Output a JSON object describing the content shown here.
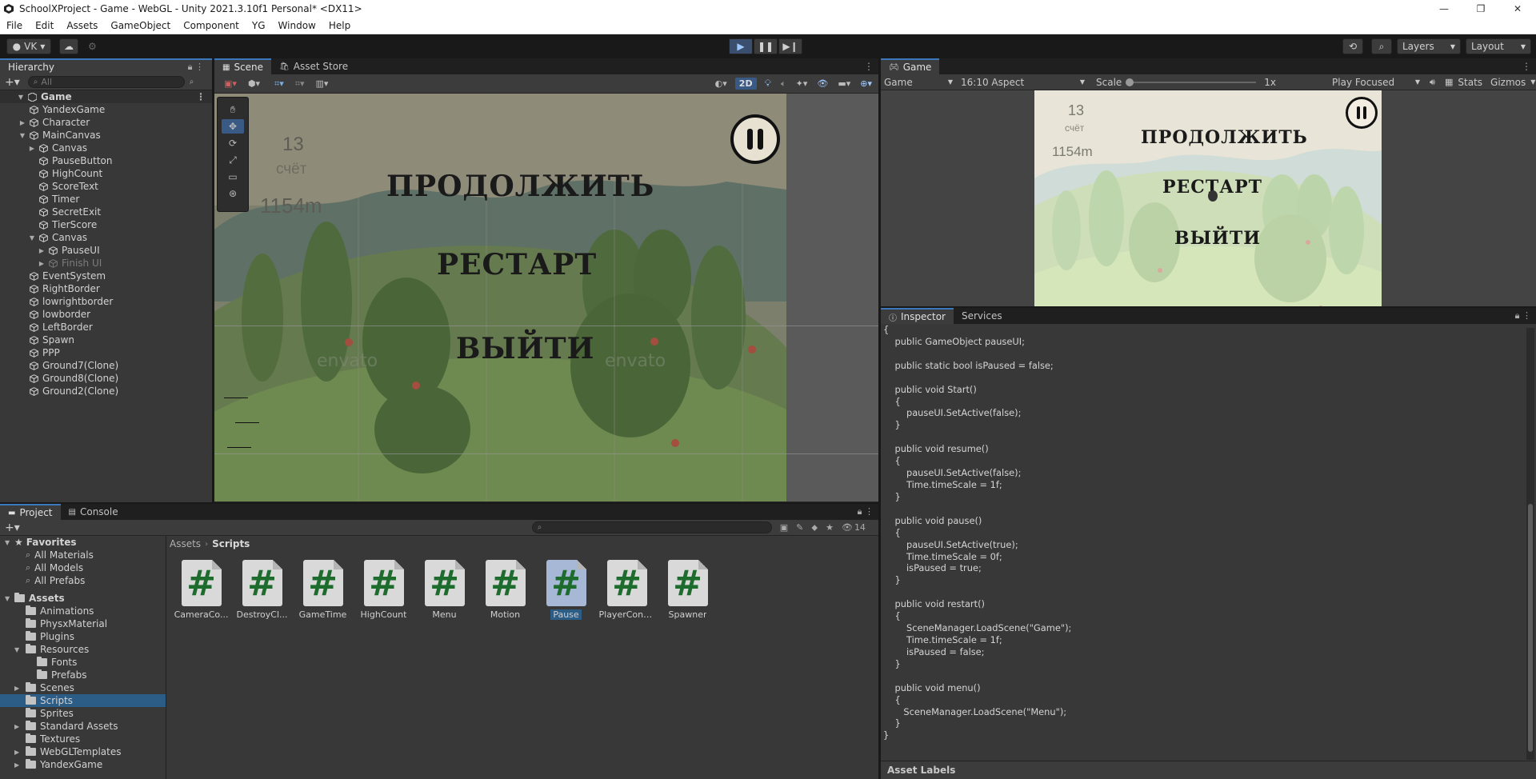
{
  "window": {
    "title": "SchoolXProject - Game - WebGL - Unity 2021.3.10f1 Personal* <DX11>",
    "controls": [
      "—",
      "❐",
      "✕"
    ]
  },
  "menu": [
    "File",
    "Edit",
    "Assets",
    "GameObject",
    "Component",
    "YG",
    "Window",
    "Help"
  ],
  "toolbar": {
    "account": "VK",
    "layers": "Layers",
    "layout": "Layout"
  },
  "hierarchy": {
    "tab": "Hierarchy",
    "search_placeholder": "All",
    "scene": "Game",
    "items": [
      {
        "label": "YandexGame",
        "indent": 1,
        "arrow": ""
      },
      {
        "label": "Character",
        "indent": 1,
        "arrow": "▶"
      },
      {
        "label": "MainCanvas",
        "indent": 1,
        "arrow": "▼"
      },
      {
        "label": "Canvas",
        "indent": 2,
        "arrow": "▶"
      },
      {
        "label": "PauseButton",
        "indent": 2,
        "arrow": ""
      },
      {
        "label": "HighCount",
        "indent": 2,
        "arrow": ""
      },
      {
        "label": "ScoreText",
        "indent": 2,
        "arrow": ""
      },
      {
        "label": "Timer",
        "indent": 2,
        "arrow": ""
      },
      {
        "label": "SecretExit",
        "indent": 2,
        "arrow": ""
      },
      {
        "label": "TierScore",
        "indent": 2,
        "arrow": ""
      },
      {
        "label": "Canvas",
        "indent": 2,
        "arrow": "▼"
      },
      {
        "label": "PauseUI",
        "indent": 3,
        "arrow": "▶"
      },
      {
        "label": "Finish UI",
        "indent": 3,
        "arrow": "▶",
        "dim": true
      },
      {
        "label": "EventSystem",
        "indent": 1,
        "arrow": ""
      },
      {
        "label": "RightBorder",
        "indent": 1,
        "arrow": ""
      },
      {
        "label": "lowrightborder",
        "indent": 1,
        "arrow": ""
      },
      {
        "label": "lowborder",
        "indent": 1,
        "arrow": ""
      },
      {
        "label": "LeftBorder",
        "indent": 1,
        "arrow": ""
      },
      {
        "label": "Spawn",
        "indent": 1,
        "arrow": ""
      },
      {
        "label": "PPP",
        "indent": 1,
        "arrow": ""
      },
      {
        "label": "Ground7(Clone)",
        "indent": 1,
        "arrow": ""
      },
      {
        "label": "Ground8(Clone)",
        "indent": 1,
        "arrow": ""
      },
      {
        "label": "Ground2(Clone)",
        "indent": 1,
        "arrow": ""
      }
    ]
  },
  "scene": {
    "tabs": [
      "Scene",
      "Asset Store"
    ],
    "mode_2d": "2D",
    "hud": {
      "score": "13",
      "score_label": "счёт",
      "distance": "1154m"
    },
    "menu": {
      "continue": "ПРОДОЛЖИТЬ",
      "restart": "РЕСТАРТ",
      "exit": "ВЫЙТИ"
    },
    "watermark": "envato"
  },
  "game": {
    "tab": "Game",
    "display": "Game",
    "aspect": "16:10 Aspect",
    "scale_label": "Scale",
    "scale_value": "1x",
    "play_mode": "Play Focused",
    "stats": "Stats",
    "gizmos": "Gizmos",
    "hud": {
      "score": "13",
      "score_label": "счёт",
      "distance": "1154m"
    },
    "menu": {
      "continue": "ПРОДОЛЖИТЬ",
      "restart": "РЕСТАРТ",
      "exit": "ВЫЙТИ"
    }
  },
  "project": {
    "tabs": [
      "Project",
      "Console"
    ],
    "hidden_count": "14",
    "breadcrumb": [
      "Assets",
      "Scripts"
    ],
    "favorites_label": "Favorites",
    "favorites": [
      "All Materials",
      "All Models",
      "All Prefabs"
    ],
    "assets_label": "Assets",
    "folders": [
      {
        "label": "Animations",
        "indent": 1,
        "arrow": ""
      },
      {
        "label": "PhysxMaterial",
        "indent": 1,
        "arrow": ""
      },
      {
        "label": "Plugins",
        "indent": 1,
        "arrow": ""
      },
      {
        "label": "Resources",
        "indent": 1,
        "arrow": "▼"
      },
      {
        "label": "Fonts",
        "indent": 2,
        "arrow": ""
      },
      {
        "label": "Prefabs",
        "indent": 2,
        "arrow": ""
      },
      {
        "label": "Scenes",
        "indent": 1,
        "arrow": "▶"
      },
      {
        "label": "Scripts",
        "indent": 1,
        "arrow": "",
        "selected": true
      },
      {
        "label": "Sprites",
        "indent": 1,
        "arrow": ""
      },
      {
        "label": "Standard Assets",
        "indent": 1,
        "arrow": "▶"
      },
      {
        "label": "Textures",
        "indent": 1,
        "arrow": ""
      },
      {
        "label": "WebGLTemplates",
        "indent": 1,
        "arrow": "▶"
      },
      {
        "label": "YandexGame",
        "indent": 1,
        "arrow": "▶"
      }
    ],
    "scripts": [
      {
        "name": "CameraCo...",
        "selected": false
      },
      {
        "name": "DestroyCl...",
        "selected": false
      },
      {
        "name": "GameTime",
        "selected": false
      },
      {
        "name": "HighCount",
        "selected": false
      },
      {
        "name": "Menu",
        "selected": false
      },
      {
        "name": "Motion",
        "selected": false
      },
      {
        "name": "Pause",
        "selected": true
      },
      {
        "name": "PlayerCont...",
        "selected": false
      },
      {
        "name": "Spawner",
        "selected": false
      }
    ]
  },
  "inspector": {
    "tabs": [
      "Inspector",
      "Services"
    ],
    "asset_labels": "Asset Labels",
    "code": [
      "{",
      "    public GameObject pauseUI;",
      "",
      "    public static bool isPaused = false;",
      "",
      "    public void Start()",
      "    {",
      "        pauseUI.SetActive(false);",
      "    }",
      "",
      "    public void resume()",
      "    {",
      "        pauseUI.SetActive(false);",
      "        Time.timeScale = 1f;",
      "    }",
      "",
      "    public void pause()",
      "    {",
      "        pauseUI.SetActive(true);",
      "        Time.timeScale = 0f;",
      "        isPaused = true;",
      "    }",
      "",
      "    public void restart()",
      "    {",
      "        SceneManager.LoadScene(\"Game\");",
      "        Time.timeScale = 1f;",
      "        isPaused = false;",
      "    }",
      "",
      "    public void menu()",
      "    {",
      "       SceneManager.LoadScene(\"Menu\");",
      "    }",
      "}"
    ]
  }
}
